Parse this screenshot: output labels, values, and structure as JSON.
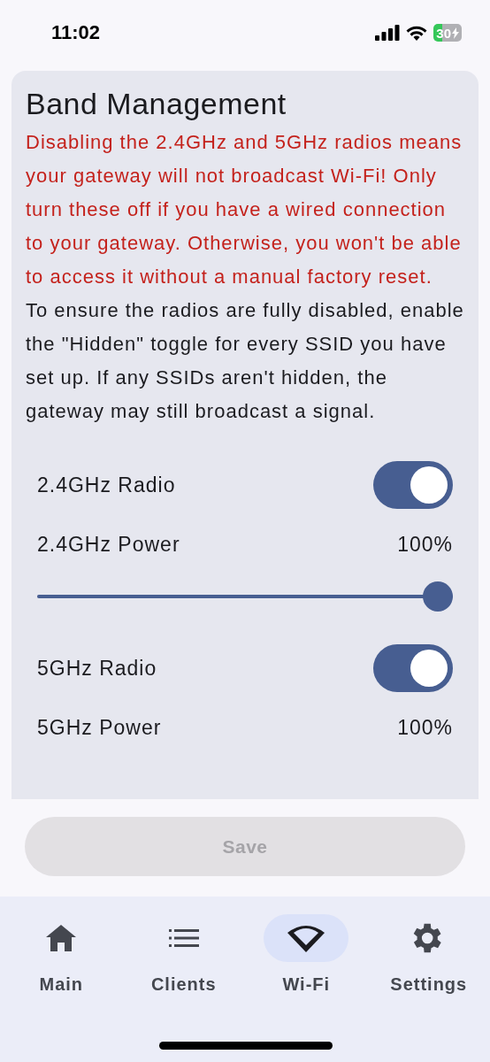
{
  "status_bar": {
    "time": "11:02",
    "battery": "30"
  },
  "card": {
    "title": "Band Management",
    "warning": "Disabling the 2.4GHz and 5GHz radios means your gateway will not broadcast Wi-Fi! Only turn these off if you have a wired connection to your gateway. Otherwise, you won't be able to access it without a manual factory reset.",
    "info": "To ensure the radios are fully disabled, enable the \"Hidden\" toggle for every SSID you have set up. If any SSIDs aren't hidden, the gateway may still broadcast a signal.",
    "settings": [
      {
        "kind": "toggle",
        "label": "2.4GHz Radio",
        "on": true
      },
      {
        "kind": "slider",
        "label": "2.4GHz Power",
        "reading": "100%",
        "level": 1
      },
      {
        "kind": "toggle",
        "label": "5GHz Radio",
        "on": true
      },
      {
        "kind": "slider",
        "label": "5GHz Power",
        "reading": "100%"
      }
    ]
  },
  "save_button": {
    "label": "Save",
    "disabled": true
  },
  "nav": [
    {
      "label": "Main",
      "selected": false
    },
    {
      "label": "Clients",
      "selected": false
    },
    {
      "label": "Wi-Fi",
      "selected": true
    },
    {
      "label": "Settings",
      "selected": false
    }
  ]
}
